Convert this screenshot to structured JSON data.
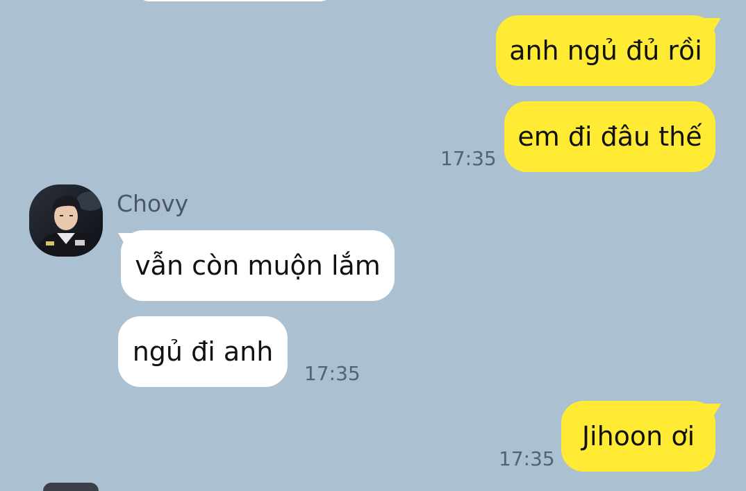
{
  "colors": {
    "background": "#abc1d1",
    "outgoing_bubble": "#ffeb33",
    "incoming_bubble": "#ffffff",
    "timestamp": "#556270",
    "sender_name": "#4a5866"
  },
  "chat": {
    "contact": {
      "name": "Chovy",
      "avatar_icon": "profile-photo-avatar"
    },
    "messages": [
      {
        "direction": "out",
        "text": "anh ngủ đủ rồi"
      },
      {
        "direction": "out",
        "text": "em đi đâu thế",
        "time": "17:35"
      },
      {
        "direction": "in",
        "text": "vẫn còn muộn lắm"
      },
      {
        "direction": "in",
        "text": "ngủ đi anh",
        "time": "17:35"
      },
      {
        "direction": "out",
        "text": "Jihoon ơi",
        "time": "17:35"
      }
    ]
  }
}
